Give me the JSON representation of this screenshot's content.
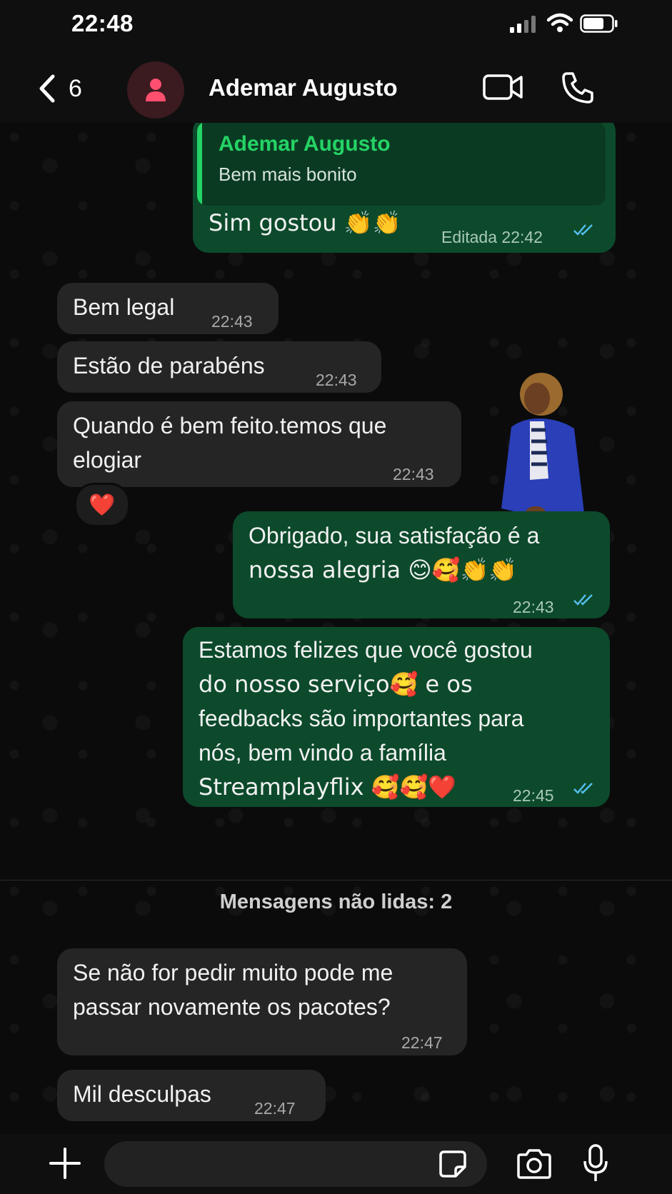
{
  "status_bar": {
    "time": "22:48"
  },
  "header": {
    "back_count": "6",
    "contact_name": "Ademar Augusto"
  },
  "messages": [
    {
      "id": "m1",
      "direction": "out",
      "quote_name": "Ademar Augusto",
      "quote_text": "Bem mais bonito",
      "text": "Sim gostou 👏👏",
      "meta": "Editada 22:42",
      "read": true
    },
    {
      "id": "m2",
      "direction": "in",
      "text": "Bem legal",
      "time": "22:43"
    },
    {
      "id": "m3",
      "direction": "in",
      "text": "Estão de parabéns",
      "time": "22:43"
    },
    {
      "id": "m4",
      "direction": "in",
      "text_line1": "Quando é bem feito.temos que",
      "text_line2": "elogiar",
      "time": "22:43",
      "reaction": "❤️"
    },
    {
      "id": "m5",
      "direction": "out",
      "text_line1": "Obrigado, sua satisfação é a",
      "text_line2": "nossa alegria 😊🥰👏👏",
      "time": "22:43",
      "read": true
    },
    {
      "id": "m6",
      "direction": "out",
      "lines": [
        "Estamos felizes que você gostou",
        "do nosso serviço🥰 e os",
        "feedbacks são importantes para",
        "nós, bem vindo a família",
        "Streamplayflix 🥰🥰❤️"
      ],
      "time": "22:45",
      "read": true
    },
    {
      "id": "m7",
      "direction": "in",
      "text_line1": "Se não for pedir muito pode me",
      "text_line2": "passar novamente os pacotes?",
      "time": "22:47"
    },
    {
      "id": "m8",
      "direction": "in",
      "text": "Mil desculpas",
      "time": "22:47"
    }
  ],
  "unread_divider": "Mensagens não lidas: 2",
  "composer": {
    "placeholder": ""
  },
  "colors": {
    "accent": "#25d366",
    "outgoing_bubble": "#0c4a2b",
    "incoming_bubble": "#252525",
    "read_ticks": "#53bdeb"
  },
  "icons": [
    "signal-icon",
    "wifi-icon",
    "battery-icon",
    "back-chevron-icon",
    "avatar-person-icon",
    "video-call-icon",
    "phone-icon",
    "plus-icon",
    "sticker-icon",
    "camera-icon",
    "microphone-icon",
    "double-check-icon"
  ]
}
